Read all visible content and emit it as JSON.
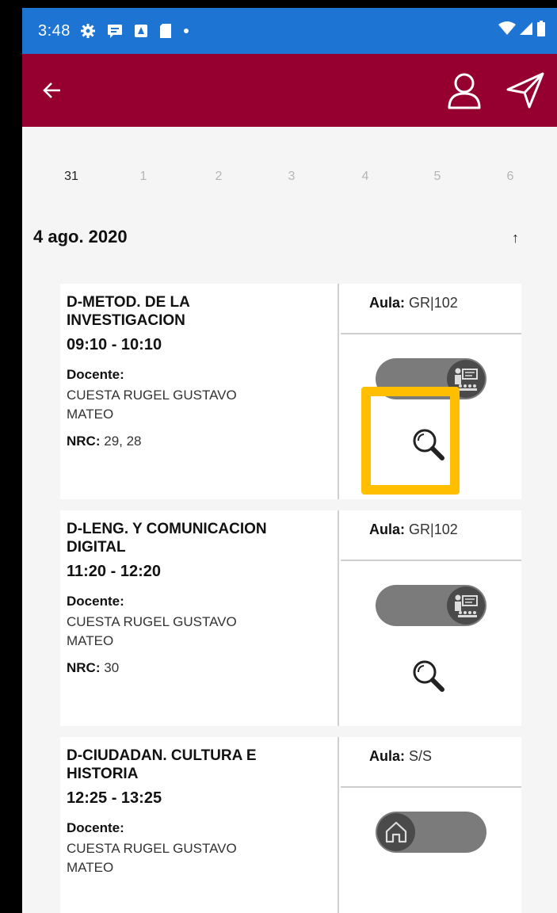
{
  "status_bar": {
    "time": "3:48"
  },
  "dates": [
    "31",
    "1",
    "2",
    "3",
    "4",
    "5",
    "6"
  ],
  "day_title": "4 ago. 2020",
  "sort_icon_glyph": "↑",
  "labels": {
    "aula": "Aula:",
    "docente": "Docente:",
    "nrc": "NRC:"
  },
  "classes": [
    {
      "course_line1": "D-METOD. DE LA",
      "course_line2": "INVESTIGACION",
      "time": "09:10 - 10:10",
      "teacher_line1": "CUESTA RUGEL GUSTAVO",
      "teacher_line2": "MATEO",
      "nrc": "29, 28",
      "aula": "GR|102",
      "mode": "presencial"
    },
    {
      "course_line1": "D-LENG. Y COMUNICACION",
      "course_line2": "DIGITAL",
      "time": "11:20 - 12:20",
      "teacher_line1": "CUESTA RUGEL GUSTAVO",
      "teacher_line2": "MATEO",
      "nrc": "30",
      "aula": "GR|102",
      "mode": "presencial"
    },
    {
      "course_line1": "D-CIUDADAN. CULTURA E",
      "course_line2": "HISTORIA",
      "time": "12:25 - 13:25",
      "teacher_line1": "CUESTA RUGEL GUSTAVO",
      "teacher_line2": "MATEO",
      "aula": "S/S",
      "mode": "casa"
    }
  ],
  "colors": {
    "status_bar": "#1e74d2",
    "app_bar": "#950030",
    "highlight": "#ffbe00",
    "toggle_track": "#7b7b7b",
    "toggle_knob": "#4a4a4a"
  },
  "icons": {
    "back": "arrow-left-icon",
    "profile": "user-icon",
    "send": "send-icon",
    "presencial": "classroom-teacher-icon",
    "casa": "home-icon",
    "detail": "magnifier-icon"
  }
}
